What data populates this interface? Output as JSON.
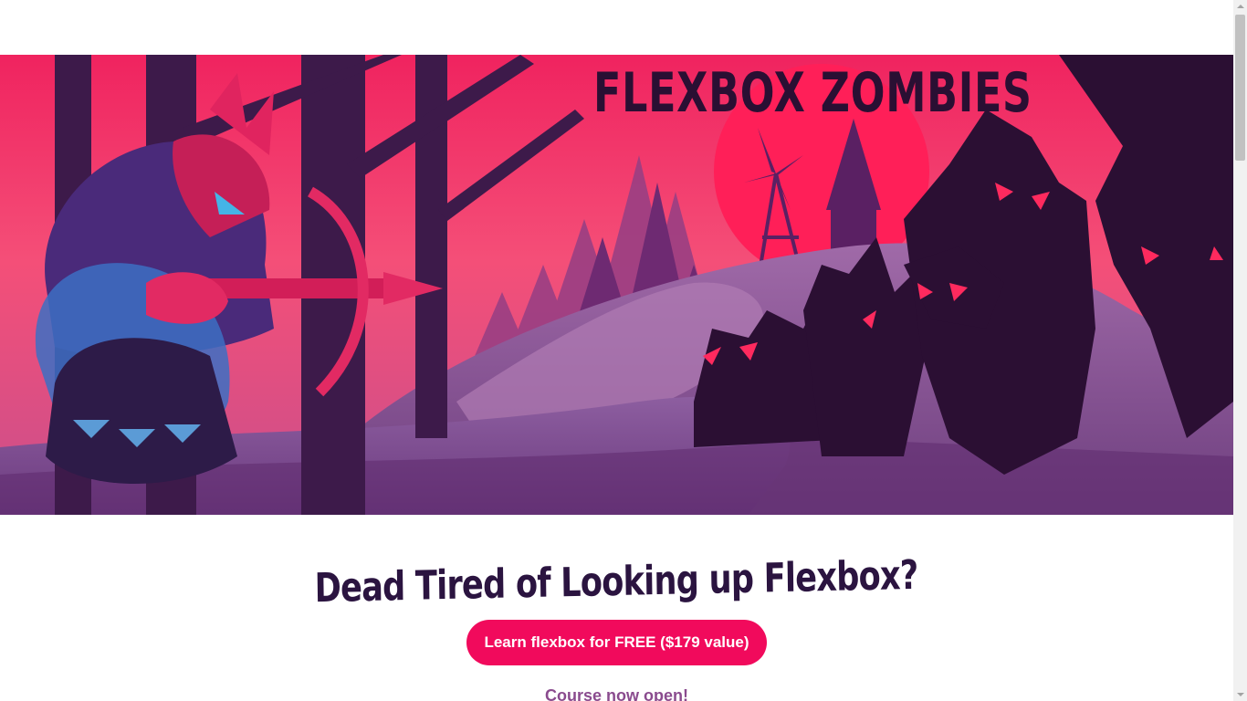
{
  "hero": {
    "title": "FLEXBOX ZOMBIES",
    "illustration_icon": "crossbow-hunter-vs-zombies-illustration",
    "colors": {
      "sky": "#f2466f",
      "sun": "#ff2a5e",
      "shadow": "#2a0f33",
      "ground": "#7e4a8c"
    }
  },
  "main": {
    "headline": "Dead Tired of Looking up Flexbox?",
    "cta_label": "Learn flexbox for FREE ($179 value)",
    "course_status": "Course now open!"
  },
  "colors": {
    "accent": "#f10a5c",
    "headline": "#2b1440",
    "subtle": "#8a4b8e"
  }
}
